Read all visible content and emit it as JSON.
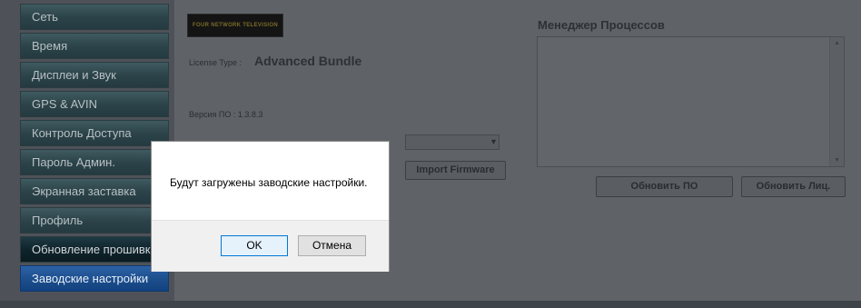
{
  "sidebar": {
    "items": [
      {
        "label": "Сеть"
      },
      {
        "label": "Время"
      },
      {
        "label": "Дисплеи и Звук"
      },
      {
        "label": "GPS & AVIN"
      },
      {
        "label": "Контроль Доступа"
      },
      {
        "label": "Пароль Админ."
      },
      {
        "label": "Экранная заставка"
      },
      {
        "label": "Профиль"
      },
      {
        "label": "Обновление прошивки"
      },
      {
        "label": "Заводские настройки"
      }
    ]
  },
  "logo": {
    "text": "FOUR NETWORK TELEVISION"
  },
  "license": {
    "label": "License Type :",
    "value": "Advanced Bundle"
  },
  "version": {
    "label": "Версия ПО : 1.3.8.3"
  },
  "firmware": {
    "select_value": "",
    "import_label": "Import Firmware"
  },
  "process_manager": {
    "title": "Менеджер Процессов"
  },
  "buttons": {
    "update_fw": "Обновить ПО",
    "update_license": "Обновить Лиц."
  },
  "dialog": {
    "message": "Будут загружены заводские настройки.",
    "ok_label": "OK",
    "cancel_label": "Отмена"
  }
}
